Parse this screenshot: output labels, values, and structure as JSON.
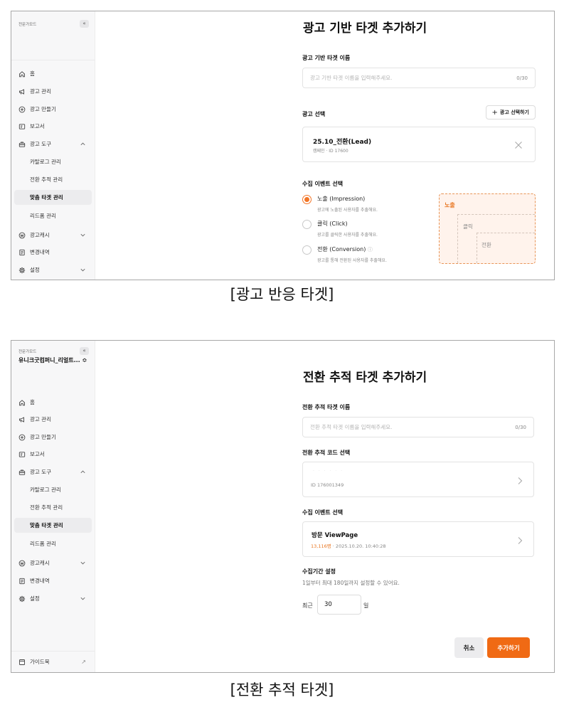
{
  "colors": {
    "accent": "#f06a14",
    "accent_text": "#e8741e",
    "funnel_bg": "#fff3ec"
  },
  "panel1": {
    "sidebar": {
      "brand": "전문가모드",
      "collapse_label": "«",
      "items": [
        {
          "label": "홈",
          "icon": "home-icon"
        },
        {
          "label": "광고 관리",
          "icon": "megaphone-icon"
        },
        {
          "label": "광고 만들기",
          "icon": "plus-circle-icon"
        },
        {
          "label": "보고서",
          "icon": "report-icon"
        },
        {
          "label": "광고 도구",
          "icon": "toolbox-icon",
          "expanded": true
        },
        {
          "label": "카탈로그 관리",
          "sub": true
        },
        {
          "label": "전환 추적 관리",
          "sub": true
        },
        {
          "label": "맞춤 타겟 관리",
          "sub": true,
          "active": true
        },
        {
          "label": "리드폼 관리",
          "sub": true
        },
        {
          "label": "광고캐시",
          "icon": "won-icon"
        },
        {
          "label": "변경내역",
          "icon": "history-icon"
        },
        {
          "label": "설정",
          "icon": "gear-icon"
        }
      ]
    },
    "title": "광고 기반 타겟 추가하기",
    "name_label": "광고 기반 타겟 이름",
    "name_placeholder": "광고 기반 타겟 이름을 입력해주세요.",
    "name_count": "0/30",
    "ad_label": "광고 선택",
    "ad_button": "광고 선택하기",
    "ad_card": {
      "title": "25.10_전환(Lead)",
      "meta": "캠페인 · ID 17600"
    },
    "event_label": "수집 이벤트 선택",
    "events": [
      {
        "title": "노출 (Impression)",
        "desc": "광고에 노출된 사용자를 추출해요.",
        "selected": true
      },
      {
        "title": "클릭 (Click)",
        "desc": "광고를 클릭한 사용자를 추출해요.",
        "selected": false
      },
      {
        "title": "전환 (Conversion)",
        "desc": "광고를 통해 전환된 사용자를 추출해요.",
        "selected": false,
        "info": "ⓘ"
      }
    ],
    "funnel": {
      "outer": "노출",
      "middle": "클릭",
      "inner": "전환"
    }
  },
  "caption1": "[광고 반응 타겟]",
  "panel2": {
    "sidebar": {
      "brand": "전문가모드",
      "collapse_label": "«",
      "account": "유니크굿컴퍼니_리얼트... ≎",
      "items": [
        {
          "label": "홈",
          "icon": "home-icon"
        },
        {
          "label": "광고 관리",
          "icon": "megaphone-icon"
        },
        {
          "label": "광고 만들기",
          "icon": "plus-circle-icon"
        },
        {
          "label": "보고서",
          "icon": "report-icon"
        },
        {
          "label": "광고 도구",
          "icon": "toolbox-icon",
          "expanded": true
        },
        {
          "label": "카탈로그 관리",
          "sub": true
        },
        {
          "label": "전환 추적 관리",
          "sub": true
        },
        {
          "label": "맞춤 타겟 관리",
          "sub": true,
          "active": true
        },
        {
          "label": "리드폼 관리",
          "sub": true
        },
        {
          "label": "광고캐시",
          "icon": "won-icon"
        },
        {
          "label": "변경내역",
          "icon": "history-icon"
        },
        {
          "label": "설정",
          "icon": "gear-icon"
        }
      ],
      "guide": "가이드북",
      "guide_arrow": "↗"
    },
    "title": "전환 추적 타겟 추가하기",
    "name_label": "전환 추적 타겟 이름",
    "name_placeholder": "전환 추적 타겟 이름을 입력해주세요.",
    "name_count": "0/30",
    "code_label": "전환 추적 코드 선택",
    "code_card": {
      "blurred": "· · · · · ·",
      "id": "ID 176001349"
    },
    "event_label": "수집 이벤트 선택",
    "event_card": {
      "title": "방문 ViewPage",
      "count": "13,116명",
      "meta": " · 2025.10.20. 10:40:28"
    },
    "period_label": "수집기간 설정",
    "period_desc": "1일부터 최대 180일까지 설정할 수 있어요.",
    "period_prefix": "최근",
    "period_value": "30",
    "period_suffix": "일",
    "cancel": "취소",
    "submit": "추가하기"
  },
  "caption2": "[전환 추적 타겟]"
}
